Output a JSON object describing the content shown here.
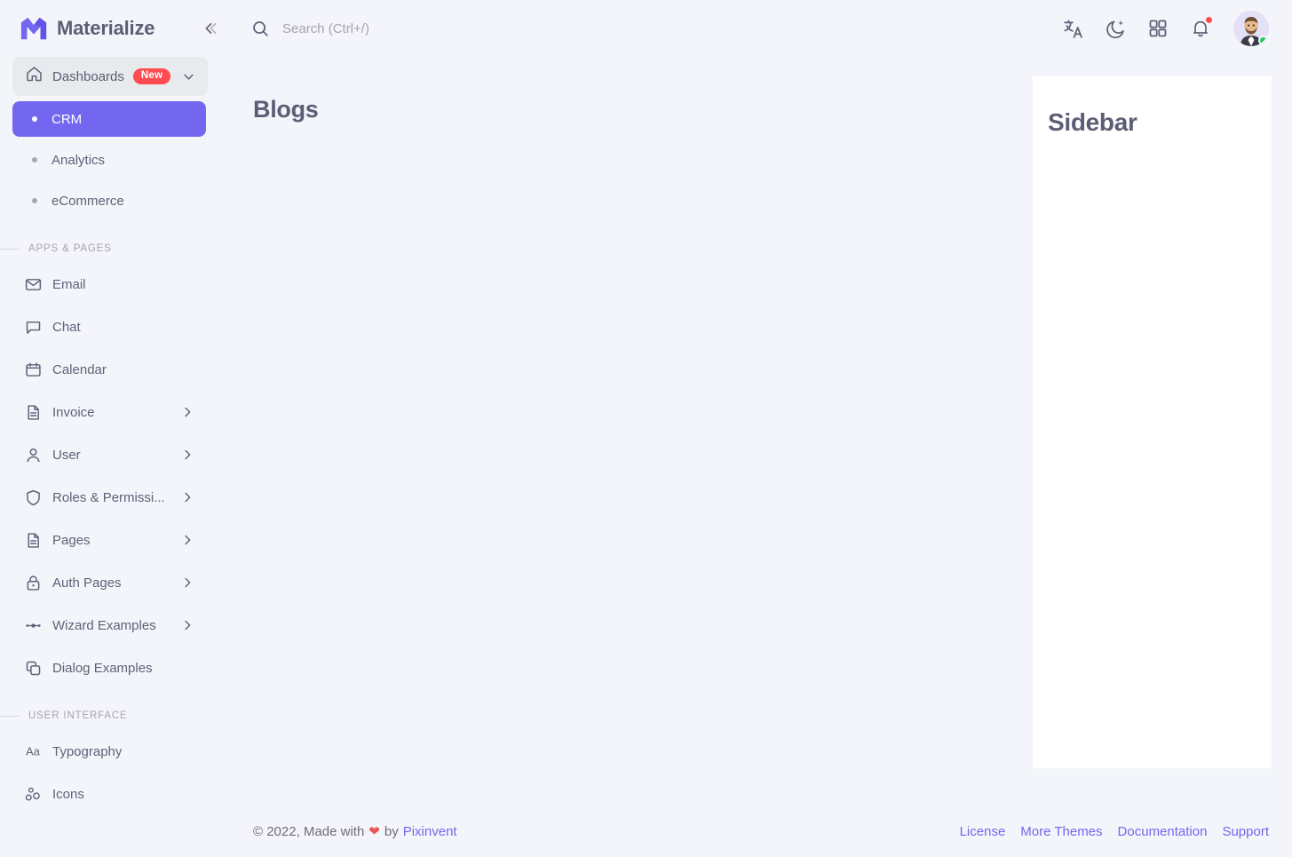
{
  "brand": {
    "name": "Materialize",
    "logo_icon": "materialize-logo-icon",
    "collapse_icon": "chevron-double-left-icon"
  },
  "topbar": {
    "search": {
      "icon": "search-icon",
      "placeholder": "Search (Ctrl+/)",
      "value": ""
    },
    "actions": [
      {
        "name": "language-icon",
        "label": "Language"
      },
      {
        "name": "moon-icon",
        "label": "Dark mode"
      },
      {
        "name": "grid-apps-icon",
        "label": "Shortcuts"
      },
      {
        "name": "bell-icon",
        "label": "Notifications",
        "has_dot": true
      }
    ],
    "avatar": {
      "name": "avatar",
      "status": "online",
      "status_color": "#28C76F"
    }
  },
  "sidebar": {
    "dashboards": {
      "label": "Dashboards",
      "icon": "home-icon",
      "badge": "New",
      "badge_color": "#FF4C51",
      "chevron": "chevron-down-icon"
    },
    "dashboard_children": [
      {
        "label": "CRM",
        "active": true
      },
      {
        "label": "Analytics",
        "active": false
      },
      {
        "label": "eCommerce",
        "active": false
      }
    ],
    "sections": [
      {
        "title": "Apps & Pages",
        "items": [
          {
            "label": "Email",
            "icon": "envelope-icon",
            "has_arrow": false
          },
          {
            "label": "Chat",
            "icon": "chat-bubble-icon",
            "has_arrow": false
          },
          {
            "label": "Calendar",
            "icon": "calendar-icon",
            "has_arrow": false
          },
          {
            "label": "Invoice",
            "icon": "file-text-icon",
            "has_arrow": true
          },
          {
            "label": "User",
            "icon": "user-icon",
            "has_arrow": true
          },
          {
            "label": "Roles & Permissi...",
            "icon": "shield-icon",
            "has_arrow": true
          },
          {
            "label": "Pages",
            "icon": "file-text-icon",
            "has_arrow": true
          },
          {
            "label": "Auth Pages",
            "icon": "lock-icon",
            "has_arrow": true
          },
          {
            "label": "Wizard Examples",
            "icon": "wizard-dots-icon",
            "has_arrow": true
          },
          {
            "label": "Dialog Examples",
            "icon": "copy-icon",
            "has_arrow": false
          }
        ]
      },
      {
        "title": "User Interface",
        "items": [
          {
            "label": "Typography",
            "icon": "typography-icon",
            "has_arrow": false
          },
          {
            "label": "Icons",
            "icon": "icons-icon",
            "has_arrow": false
          }
        ]
      }
    ]
  },
  "main": {
    "page_title": "Blogs"
  },
  "side_panel": {
    "title": "Sidebar"
  },
  "footer": {
    "copyright_prefix": "© 2022, Made with",
    "heart": "❤",
    "by": "by",
    "author": "Pixinvent",
    "links": [
      {
        "label": "License"
      },
      {
        "label": "More Themes"
      },
      {
        "label": "Documentation"
      },
      {
        "label": "Support"
      }
    ]
  },
  "colors": {
    "primary": "#7367F0",
    "background": "#F4F5FA",
    "surface": "#FFFFFF",
    "text": "#5E6278",
    "danger": "#FF4C51",
    "success": "#28C76F"
  }
}
